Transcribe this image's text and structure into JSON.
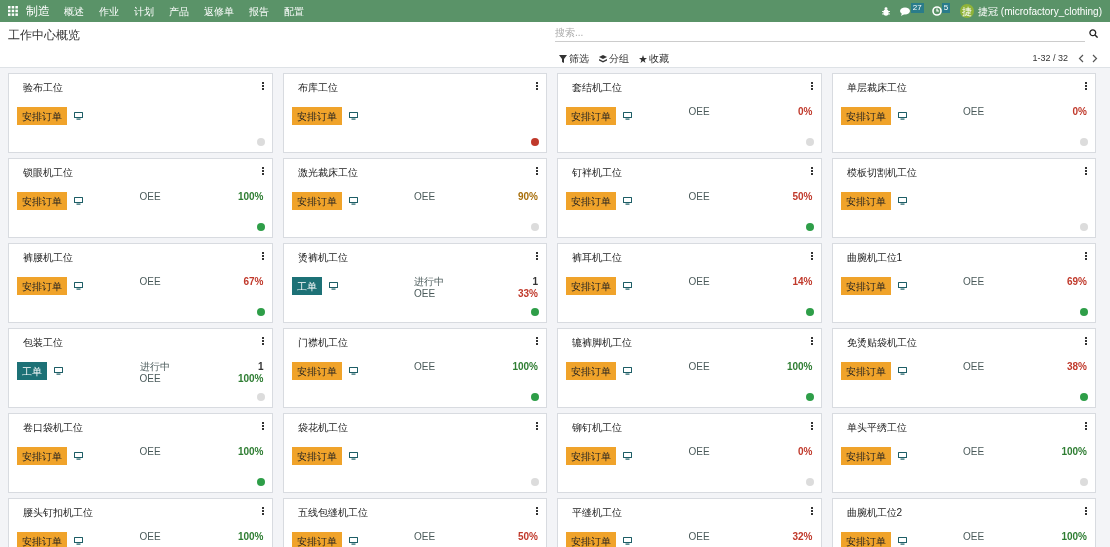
{
  "navbar": {
    "app": "制造",
    "menu": [
      "概述",
      "作业",
      "计划",
      "产品",
      "返修单",
      "报告",
      "配置"
    ],
    "messages_count": "27",
    "activities_count": "5",
    "avatar_letter": "捷",
    "user": "捷冠 (microfactory_clothing)"
  },
  "title": "工作中心概览",
  "search": {
    "placeholder": "搜索..."
  },
  "filters": [
    {
      "kind": "filter",
      "label": "筛选"
    },
    {
      "kind": "group",
      "label": "分组"
    },
    {
      "kind": "favorite",
      "label": "收藏"
    }
  ],
  "pager": "1-32 / 32",
  "cards": [
    {
      "name": "验布工位",
      "button": {
        "kind": "plan",
        "label": "安排订单"
      },
      "color": "#dcdcdc"
    },
    {
      "name": "布库工位",
      "button": {
        "kind": "plan",
        "label": "安排订单"
      },
      "color": "#c0392b"
    },
    {
      "name": "套结机工位",
      "button": {
        "kind": "plan",
        "label": "安排订单"
      },
      "rows": [
        {
          "label": "OEE",
          "value": "0%",
          "color": "#c0392b"
        }
      ],
      "color": "#dcdcdc"
    },
    {
      "name": "单层裁床工位",
      "button": {
        "kind": "plan",
        "label": "安排订单"
      },
      "rows": [
        {
          "label": "OEE",
          "value": "0%",
          "color": "#c0392b"
        }
      ],
      "color": "#dcdcdc"
    },
    {
      "name": "锁眼机工位",
      "button": {
        "kind": "plan",
        "label": "安排订单"
      },
      "rows": [
        {
          "label": "OEE",
          "value": "100%",
          "color": "#2e7d32"
        }
      ],
      "color": "#2e9e48"
    },
    {
      "name": "激光裁床工位",
      "button": {
        "kind": "plan",
        "label": "安排订单"
      },
      "rows": [
        {
          "label": "OEE",
          "value": "90%",
          "color": "#a86f0c"
        }
      ],
      "color": "#dcdcdc"
    },
    {
      "name": "钉袢机工位",
      "button": {
        "kind": "plan",
        "label": "安排订单"
      },
      "rows": [
        {
          "label": "OEE",
          "value": "50%",
          "color": "#c0392b"
        }
      ],
      "color": "#2e9e48"
    },
    {
      "name": "模板切割机工位",
      "button": {
        "kind": "plan",
        "label": "安排订单"
      },
      "color": "#dcdcdc"
    },
    {
      "name": "裤腰机工位",
      "button": {
        "kind": "plan",
        "label": "安排订单"
      },
      "rows": [
        {
          "label": "OEE",
          "value": "67%",
          "color": "#c0392b"
        }
      ],
      "color": "#2e9e48"
    },
    {
      "name": "烫裤机工位",
      "button": {
        "kind": "workorder",
        "label": "工单"
      },
      "rows": [
        {
          "label": "进行中",
          "value": "1"
        },
        {
          "label": "OEE",
          "value": "33%",
          "color": "#c0392b"
        }
      ],
      "color": "#2e9e48"
    },
    {
      "name": "裤耳机工位",
      "button": {
        "kind": "plan",
        "label": "安排订单"
      },
      "rows": [
        {
          "label": "OEE",
          "value": "14%",
          "color": "#c0392b"
        }
      ],
      "color": "#2e9e48"
    },
    {
      "name": "曲腕机工位1",
      "button": {
        "kind": "plan",
        "label": "安排订单"
      },
      "rows": [
        {
          "label": "OEE",
          "value": "69%",
          "color": "#c0392b"
        }
      ],
      "color": "#2e9e48"
    },
    {
      "name": "包装工位",
      "button": {
        "kind": "workorder",
        "label": "工单"
      },
      "rows": [
        {
          "label": "进行中",
          "value": "1"
        },
        {
          "label": "OEE",
          "value": "100%",
          "color": "#2e7d32"
        }
      ],
      "color": "#dcdcdc"
    },
    {
      "name": "门襟机工位",
      "button": {
        "kind": "plan",
        "label": "安排订单"
      },
      "rows": [
        {
          "label": "OEE",
          "value": "100%",
          "color": "#2e7d32"
        }
      ],
      "color": "#2e9e48"
    },
    {
      "name": "辘裤脚机工位",
      "button": {
        "kind": "plan",
        "label": "安排订单"
      },
      "rows": [
        {
          "label": "OEE",
          "value": "100%",
          "color": "#2e7d32"
        }
      ],
      "color": "#2e9e48"
    },
    {
      "name": "免烫贴袋机工位",
      "button": {
        "kind": "plan",
        "label": "安排订单"
      },
      "rows": [
        {
          "label": "OEE",
          "value": "38%",
          "color": "#c0392b"
        }
      ],
      "color": "#2e9e48"
    },
    {
      "name": "卷口袋机工位",
      "button": {
        "kind": "plan",
        "label": "安排订单"
      },
      "rows": [
        {
          "label": "OEE",
          "value": "100%",
          "color": "#2e7d32"
        }
      ],
      "color": "#2e9e48"
    },
    {
      "name": "袋花机工位",
      "button": {
        "kind": "plan",
        "label": "安排订单"
      },
      "color": "#dcdcdc"
    },
    {
      "name": "铆钉机工位",
      "button": {
        "kind": "plan",
        "label": "安排订单"
      },
      "rows": [
        {
          "label": "OEE",
          "value": "0%",
          "color": "#c0392b"
        }
      ],
      "color": "#dcdcdc"
    },
    {
      "name": "单头平绣工位",
      "button": {
        "kind": "plan",
        "label": "安排订单"
      },
      "rows": [
        {
          "label": "OEE",
          "value": "100%",
          "color": "#2e7d32"
        }
      ],
      "color": "#dcdcdc"
    },
    {
      "name": "腰头钉扣机工位",
      "button": {
        "kind": "plan",
        "label": "安排订单"
      },
      "rows": [
        {
          "label": "OEE",
          "value": "100%",
          "color": "#2e7d32"
        }
      ]
    },
    {
      "name": "五线包缝机工位",
      "button": {
        "kind": "plan",
        "label": "安排订单"
      },
      "rows": [
        {
          "label": "OEE",
          "value": "50%",
          "color": "#c0392b"
        }
      ]
    },
    {
      "name": "平缝机工位",
      "button": {
        "kind": "plan",
        "label": "安排订单"
      },
      "rows": [
        {
          "label": "OEE",
          "value": "32%",
          "color": "#c0392b"
        }
      ]
    },
    {
      "name": "曲腕机工位2",
      "button": {
        "kind": "plan",
        "label": "安排订单"
      },
      "rows": [
        {
          "label": "OEE",
          "value": "100%",
          "color": "#2e7d32"
        }
      ]
    }
  ]
}
